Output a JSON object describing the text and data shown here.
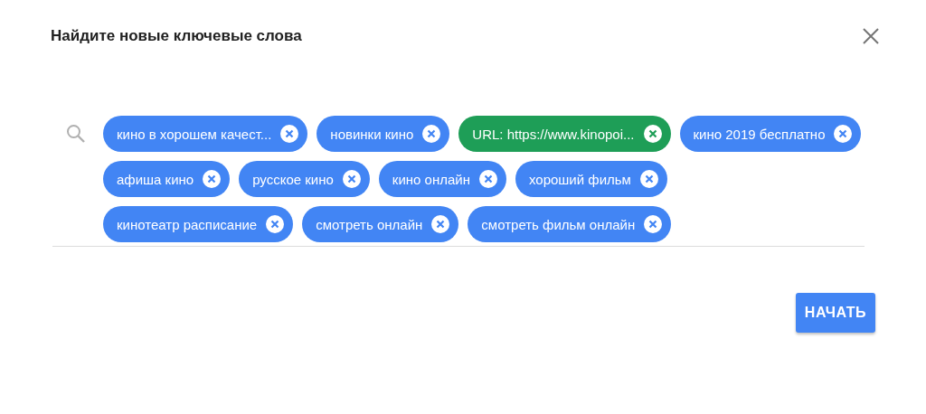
{
  "dialog": {
    "title": "Найдите новые ключевые слова"
  },
  "chips": [
    {
      "kind": "keyword",
      "label": "кино в хорошем качест..."
    },
    {
      "kind": "keyword",
      "label": "новинки кино"
    },
    {
      "kind": "url",
      "label": "URL: https://www.kinopoi..."
    },
    {
      "kind": "keyword",
      "label": "кино 2019 бесплатно"
    },
    {
      "kind": "keyword",
      "label": "афиша кино"
    },
    {
      "kind": "keyword",
      "label": "русское кино"
    },
    {
      "kind": "keyword",
      "label": "кино онлайн"
    },
    {
      "kind": "keyword",
      "label": "хороший фильм"
    },
    {
      "kind": "keyword",
      "label": "кинотеатр расписание"
    },
    {
      "kind": "keyword",
      "label": "смотреть онлайн"
    },
    {
      "kind": "keyword",
      "label": "смотреть фильм онлайн"
    }
  ],
  "start_button": "НАЧАТЬ"
}
